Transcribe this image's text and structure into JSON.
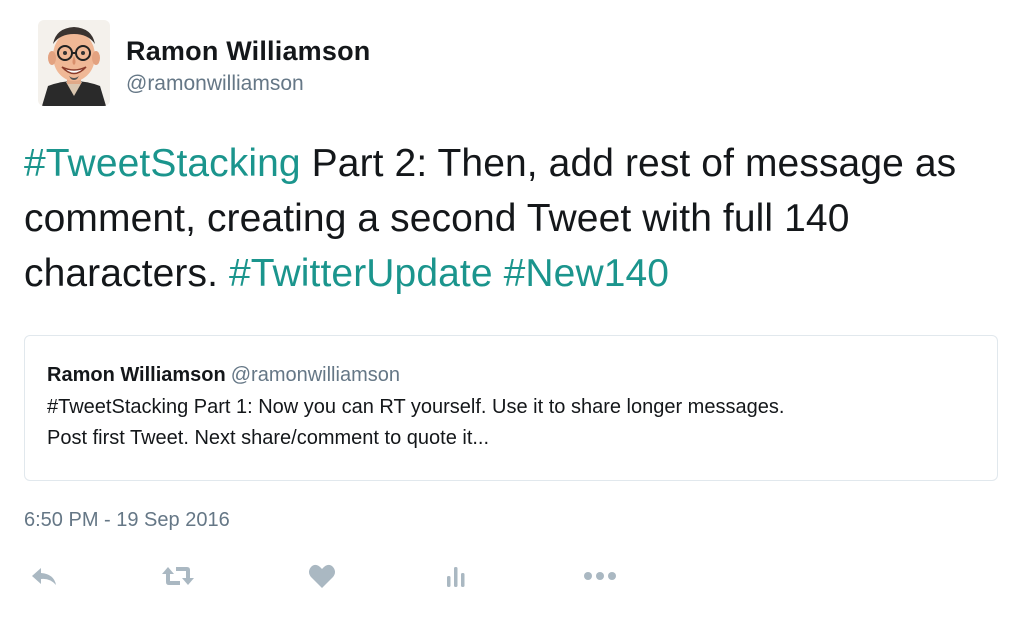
{
  "author": {
    "display_name": "Ramon Williamson",
    "handle": "@ramonwilliamson"
  },
  "tweet": {
    "segments": [
      {
        "text": "#TweetStacking",
        "type": "hashtag"
      },
      {
        "text": " Part 2: Then, add rest of message as comment, creating a second Tweet with full 140 characters. ",
        "type": "text"
      },
      {
        "text": "#TwitterUpdate",
        "type": "hashtag"
      },
      {
        "text": " ",
        "type": "text"
      },
      {
        "text": "#New140",
        "type": "hashtag"
      }
    ],
    "timestamp": "6:50 PM - 19 Sep 2016"
  },
  "quoted_tweet": {
    "display_name": "Ramon Williamson",
    "handle": "@ramonwilliamson",
    "text_line1": "#TweetStacking Part 1: Now you can RT yourself. Use it to share longer messages.",
    "text_line2": "Post first Tweet. Next share/comment to quote it..."
  },
  "actions": [
    {
      "name": "reply",
      "icon": "reply-icon"
    },
    {
      "name": "retweet",
      "icon": "retweet-icon"
    },
    {
      "name": "like",
      "icon": "heart-icon"
    },
    {
      "name": "analytics",
      "icon": "analytics-icon"
    },
    {
      "name": "more",
      "icon": "more-icon"
    }
  ],
  "colors": {
    "hashtag": "#1b958d",
    "secondary_text": "#657786",
    "action_icon": "#aab8c2",
    "border": "#e1e8ed"
  }
}
